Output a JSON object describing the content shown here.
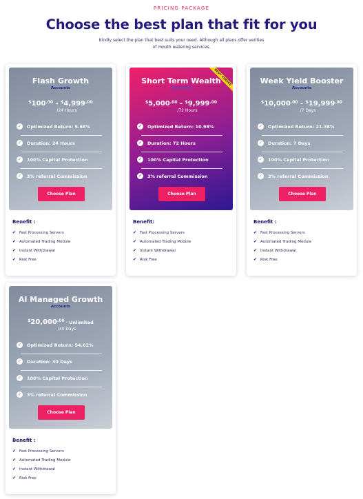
{
  "header": {
    "eyebrow": "PRICING PACKAGE",
    "title": "Choose the best plan that fit for you",
    "subtitle": "Kindly select the plan that best suits your need. Although all plans offer verities of mouth watering services."
  },
  "colors": {
    "accent": "#ec1a62",
    "title": "#231a7c",
    "ribbon": "#f7d21c"
  },
  "plans": [
    {
      "name": "Flash Growth",
      "subtitle": "Accounts",
      "price_min_cur": "$",
      "price_min": "100",
      "price_min_dec": ".00",
      "price_sep": " - ",
      "price_max_cur": "$",
      "price_max": "4,999",
      "price_max_dec": ".00",
      "period": "/24 Hours",
      "features": [
        "Optimized Return: 5.68%",
        "Duration: 24 Hours",
        "100% Capital Protection",
        "3% referral Commission"
      ],
      "button": "Choose Plan",
      "badge": "",
      "benefit_title": "Benefit :",
      "benefits": [
        "Fast Processing Servers",
        "Automated Trading Module",
        "Instant Withdrawal",
        "Risk Free"
      ]
    },
    {
      "name": "Short Term Wealth",
      "subtitle": "Accounts",
      "price_min_cur": "$",
      "price_min": "5,000",
      "price_min_dec": ".00",
      "price_sep": " - ",
      "price_max_cur": "$",
      "price_max": "9,999",
      "price_max_dec": ".00",
      "period": "/72 Hours",
      "features": [
        "Optimized Return: 10.98%",
        "Duration: 72 Hours",
        "100% Capital Protection",
        "3% referral Commission"
      ],
      "button": "Choose Plan",
      "badge": "BEST CHOICE",
      "benefit_title": "Benefit:",
      "benefits": [
        "Fast Processing Servers",
        "Automated Trading Module",
        "Instant Withdrawal",
        "Risk Free"
      ]
    },
    {
      "name": "Week Yield Booster",
      "subtitle": "Accounts",
      "price_min_cur": "$",
      "price_min": "10,000",
      "price_min_dec": ".00",
      "price_sep": " - ",
      "price_max_cur": "$",
      "price_max": "19,999",
      "price_max_dec": ".00",
      "period": "/7 Days",
      "features": [
        "Optimized Return: 21.38%",
        "Duration: 7 Days",
        "100% Capital Protection",
        "3% referral Commission"
      ],
      "button": "Choose Plan",
      "badge": "",
      "benefit_title": "Benefit :",
      "benefits": [
        "Fast Processing Servers",
        "Automated Trading Module",
        "Instant Withdrawal",
        "Risk Free"
      ]
    },
    {
      "name": "AI Managed Growth",
      "subtitle": "Accounts",
      "price_min_cur": "$",
      "price_min": "20,000",
      "price_min_dec": ".00",
      "price_sep": " - ",
      "price_max_cur": "",
      "price_max": "Unlimited",
      "price_max_dec": "",
      "period": "/30 Days",
      "features": [
        "Optimized Return: 54.62%",
        "Duration: 30 Days",
        "100% Capital Protection",
        "3% referral Commission"
      ],
      "button": "Choose Plan",
      "badge": "",
      "benefit_title": "Benefit :",
      "benefits": [
        "Fast Processing Servers",
        "Automated Trading Module",
        "Instant Withdrawal",
        "Risk Free"
      ]
    }
  ]
}
